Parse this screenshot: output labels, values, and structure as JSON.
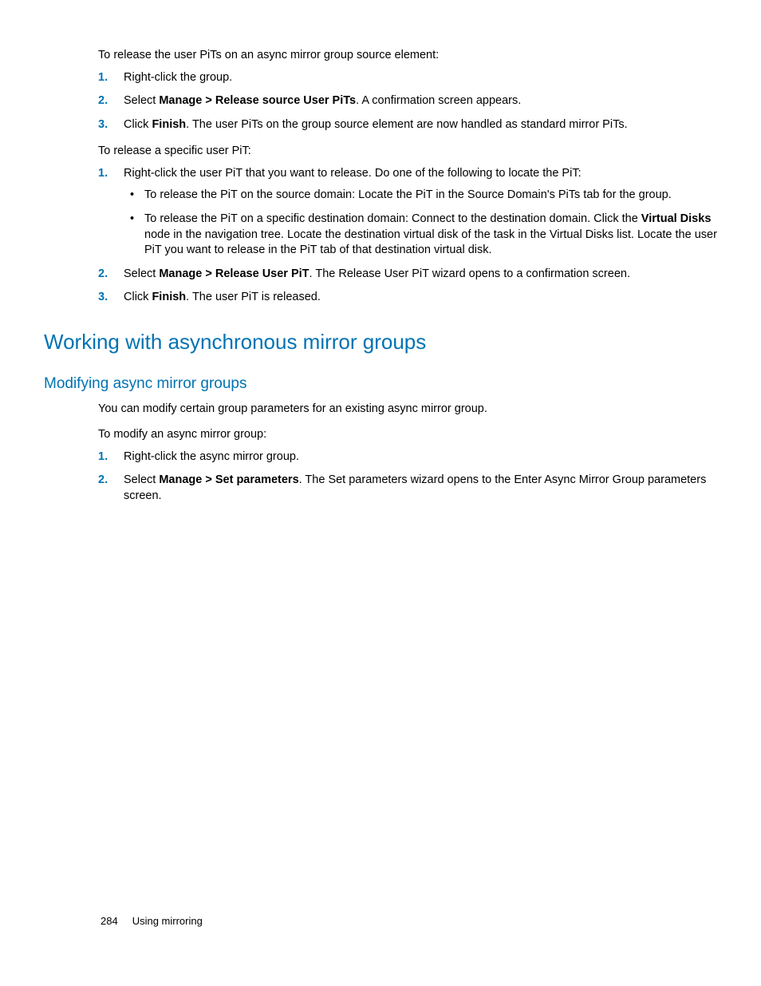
{
  "section1": {
    "intro": "To release the user PiTs on an async mirror group source element:",
    "steps": [
      {
        "text": "Right-click the group."
      },
      {
        "prefix": "Select ",
        "bold": "Manage > Release source User PiTs",
        "suffix": ". A confirmation screen appears."
      },
      {
        "prefix": "Click ",
        "bold": "Finish",
        "suffix": ". The user PiTs on the group source element are now handled as standard mirror PiTs."
      }
    ]
  },
  "section2": {
    "intro": "To release a specific user PiT:",
    "step1": "Right-click the user PiT that you want to release. Do one of the following to locate the PiT:",
    "bullets": [
      {
        "text": "To release the PiT on the source domain: Locate the PiT in the Source Domain's PiTs tab for the group."
      },
      {
        "prefix": "To release the PiT on a specific destination domain: Connect to the destination domain. Click the ",
        "bold": "Virtual Disks",
        "suffix": " node in the navigation tree. Locate the destination virtual disk of the task in the Virtual Disks list. Locate the user PiT you want to release in the PiT tab of that destination virtual disk."
      }
    ],
    "step2": {
      "prefix": "Select ",
      "bold": "Manage > Release User PiT",
      "suffix": ". The Release User PiT wizard opens to a confirmation screen."
    },
    "step3": {
      "prefix": "Click ",
      "bold": "Finish",
      "suffix": ". The user PiT is released."
    }
  },
  "heading1": "Working with asynchronous mirror groups",
  "heading2": "Modifying async mirror groups",
  "section3": {
    "intro1": "You can modify certain group parameters for an existing async mirror group.",
    "intro2": "To modify an async mirror group:",
    "step1": "Right-click the async mirror group.",
    "step2": {
      "prefix": "Select ",
      "bold": "Manage > Set parameters",
      "suffix": ". The Set parameters wizard opens to the Enter Async Mirror Group parameters screen."
    }
  },
  "footer": {
    "page": "284",
    "chapter": "Using mirroring"
  }
}
